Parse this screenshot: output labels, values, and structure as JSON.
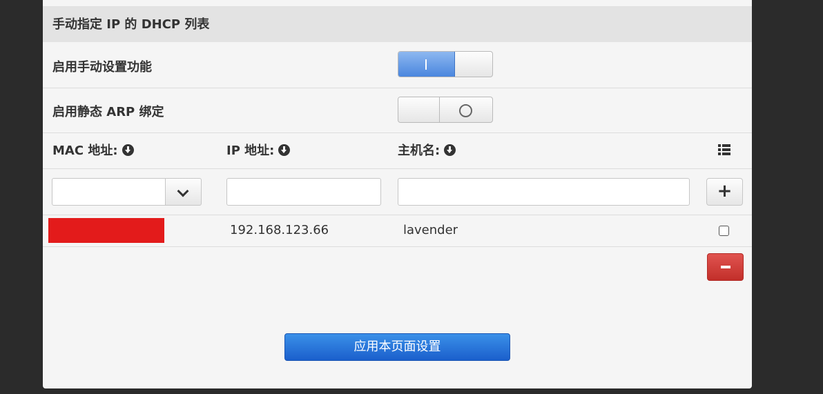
{
  "section": {
    "title": "手动指定 IP 的 DHCP 列表"
  },
  "settings": {
    "manual_enable_label": "启用手动设置功能",
    "manual_enable_on": true,
    "static_arp_label": "启用静态 ARP 绑定",
    "static_arp_on": false
  },
  "table": {
    "columns": [
      "MAC 地址:",
      "IP 地址:",
      "主机名:"
    ],
    "new_entry": {
      "mac": "",
      "ip": "",
      "hostname": ""
    },
    "rows": [
      {
        "mac": "",
        "ip": "192.168.123.66",
        "hostname": "lavender",
        "checked": false
      }
    ]
  },
  "buttons": {
    "apply_label": "应用本页面设置"
  },
  "icons": {
    "sort": "circle-arrow-down-icon",
    "list": "list-icon",
    "add": "plus-icon",
    "delete": "minus-icon",
    "dropdown": "chevron-down-icon"
  }
}
